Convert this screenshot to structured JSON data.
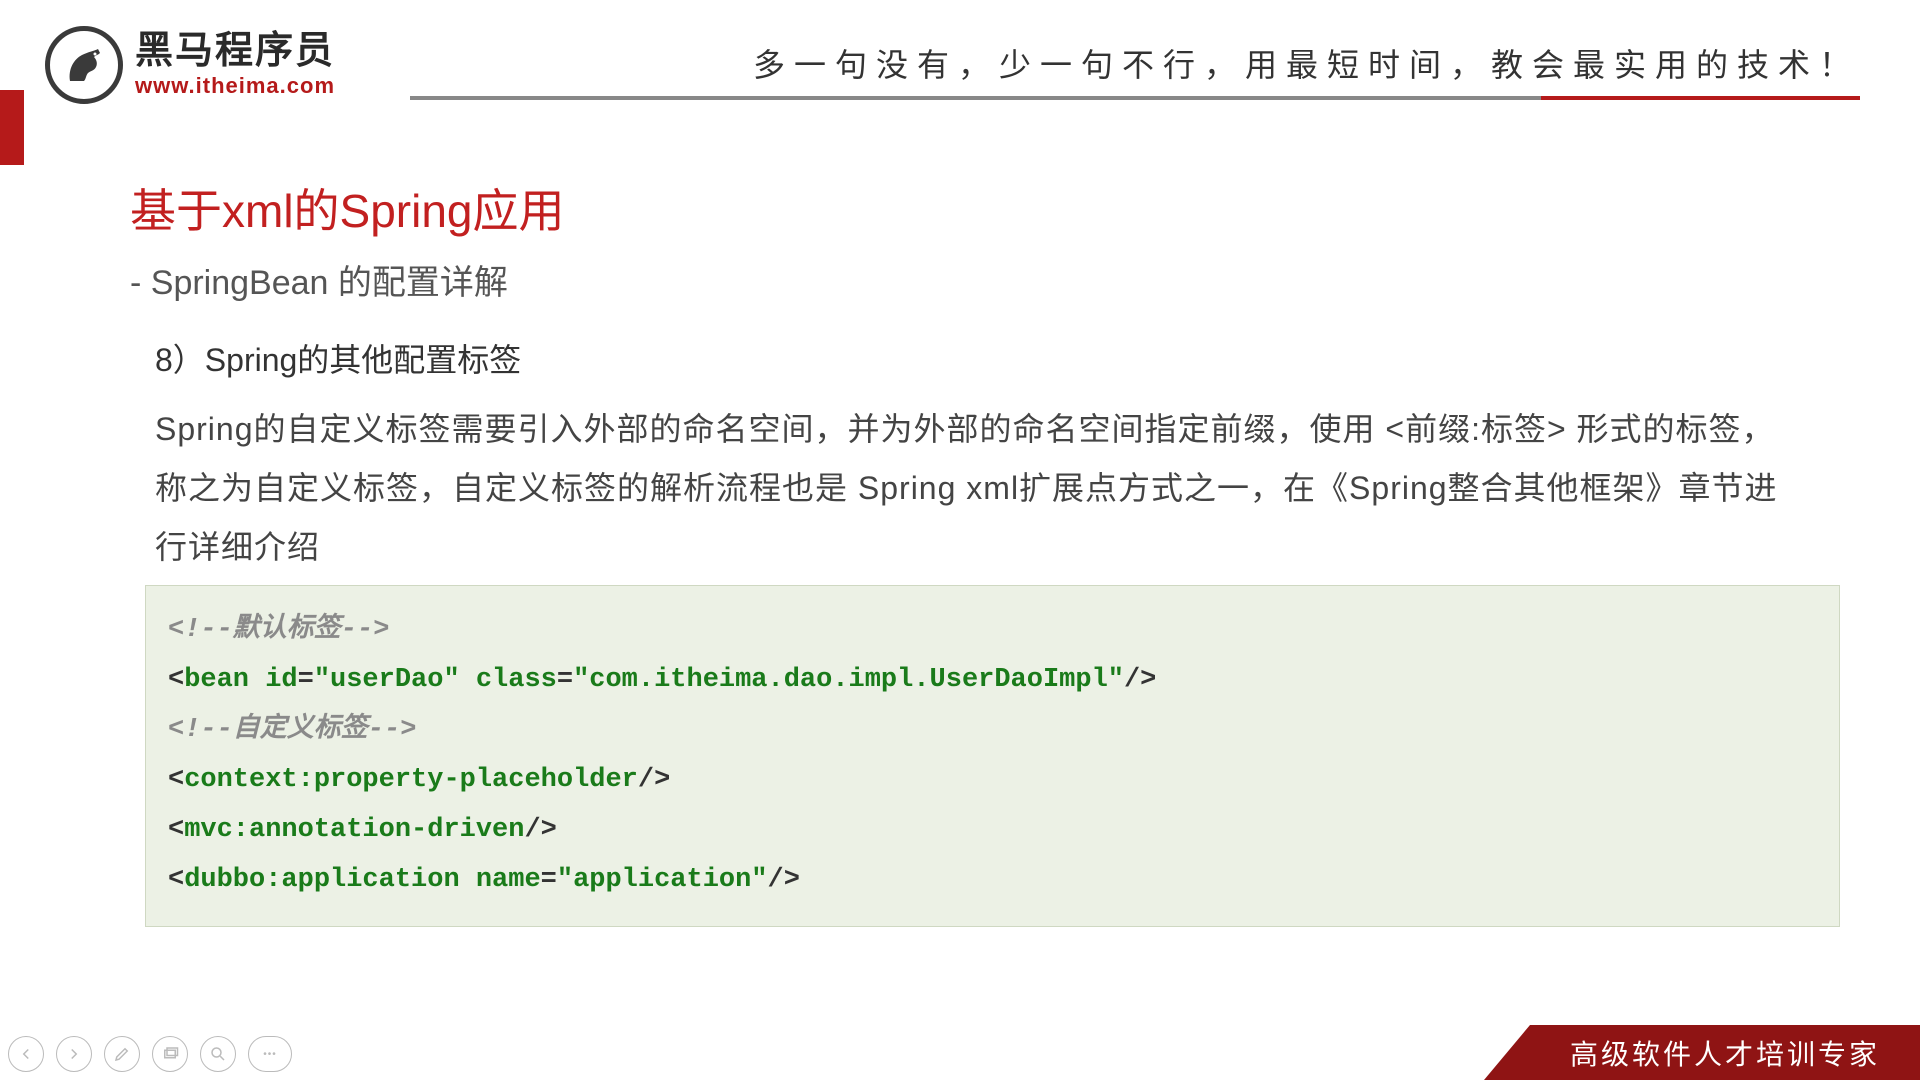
{
  "logo": {
    "cn": "黑马程序员",
    "url": "www.itheima.com"
  },
  "slogan": "多一句没有，少一句不行，用最短时间，教会最实用的技术！",
  "title": "基于xml的Spring应用",
  "subtitle": "- SpringBean 的配置详解",
  "section_head": "8）Spring的其他配置标签",
  "paragraph": "Spring的自定义标签需要引入外部的命名空间，并为外部的命名空间指定前缀，使用 <前缀:标签> 形式的标签，称之为自定义标签，自定义标签的解析流程也是 Spring xml扩展点方式之一，在《Spring整合其他框架》章节进行详细介绍",
  "code": {
    "comment1": "<!--默认标签-->",
    "l2_tag": "bean",
    "l2_attr1": "id",
    "l2_val1": "\"userDao\"",
    "l2_attr2": "class",
    "l2_val2": "\"com.itheima.dao.impl.UserDaoImpl\"",
    "comment2": "<!--自定义标签-->",
    "l4_tag": "context:property-placeholder",
    "l5_tag": "mvc:annotation-driven",
    "l6_tag": "dubbo:application",
    "l6_attr": "name",
    "l6_val": "\"application\""
  },
  "footer": "高级软件人才培训专家",
  "toolbar": {
    "more": "•••"
  }
}
